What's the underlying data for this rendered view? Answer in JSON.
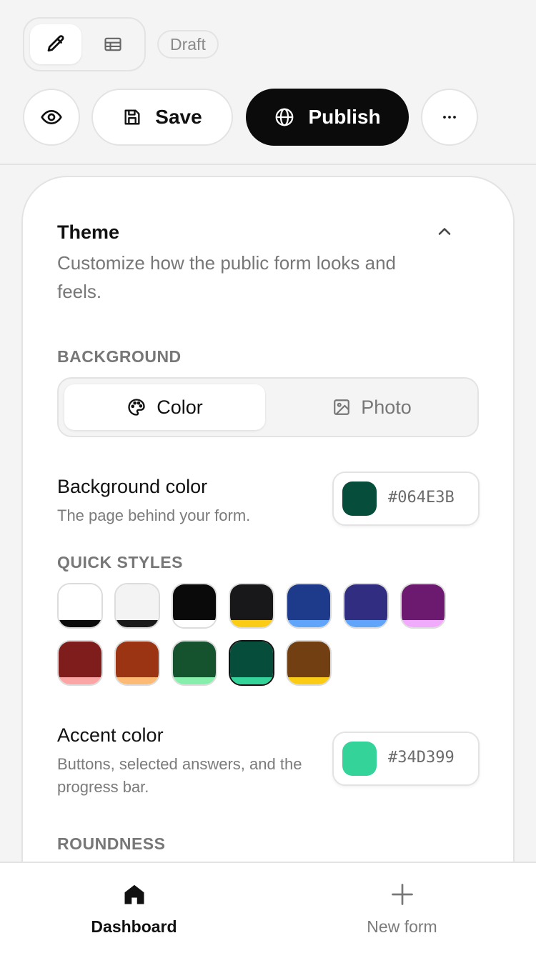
{
  "toolbar": {
    "draft_label": "Draft",
    "save_label": "Save",
    "publish_label": "Publish",
    "more_label": "···"
  },
  "theme": {
    "title": "Theme",
    "description": "Customize how the public form looks and feels.",
    "background_label": "BACKGROUND",
    "background_options": [
      "Color",
      "Photo"
    ],
    "background_selected": "Color",
    "background_color": {
      "title": "Background color",
      "description": "The page behind your form.",
      "value": "#064E3B"
    },
    "quick_styles_label": "QUICK STYLES",
    "quick_styles": [
      {
        "bg": "#ffffff",
        "accent": "#0b0b0b"
      },
      {
        "bg": "#f3f3f3",
        "accent": "#1a1a1a"
      },
      {
        "bg": "#0a0a0a",
        "accent": "#ffffff"
      },
      {
        "bg": "#18181b",
        "accent": "#facc15"
      },
      {
        "bg": "#1e3a8a",
        "accent": "#60a5fa"
      },
      {
        "bg": "#312e81",
        "accent": "#60a5fa"
      },
      {
        "bg": "#6b1a6f",
        "accent": "#f0abfc"
      },
      {
        "bg": "#7f1d1d",
        "accent": "#fca5a5"
      },
      {
        "bg": "#9a3412",
        "accent": "#fdba74"
      },
      {
        "bg": "#14532d",
        "accent": "#86efac"
      },
      {
        "bg": "#064e3b",
        "accent": "#34d399",
        "selected": true
      },
      {
        "bg": "#713f12",
        "accent": "#facc15"
      }
    ],
    "accent_color": {
      "title": "Accent color",
      "description": "Buttons, selected answers, and the progress bar.",
      "value": "#34D399"
    },
    "roundness_label": "ROUNDNESS"
  },
  "nav": {
    "dashboard_label": "Dashboard",
    "new_form_label": "New form"
  }
}
